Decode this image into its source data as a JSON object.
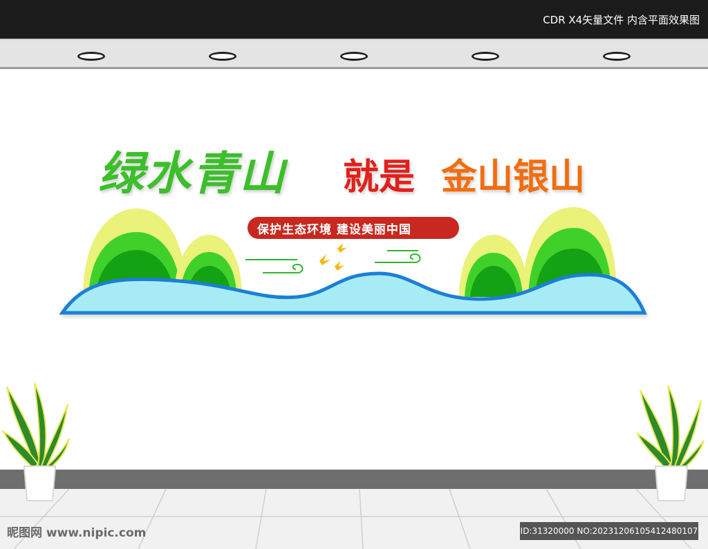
{
  "top_bar": {
    "caption": "CDR X4矢量文件  内含平面效果图"
  },
  "slogan": {
    "part_green": "绿水青山",
    "part_red": "就是",
    "part_orange": "金山银山"
  },
  "subtitle": "保护生态环境  建设美丽中国",
  "watermarks": {
    "left": "昵图网 www.nipic.com",
    "right": "ID:31320000 NO:20231206105412480107"
  },
  "colors": {
    "green": "#3cbf2a",
    "red": "#e0201a",
    "orange": "#f26d10",
    "water": "#a7ecf5",
    "water_edge": "#1f7fd6",
    "pill": "#c8281f"
  }
}
